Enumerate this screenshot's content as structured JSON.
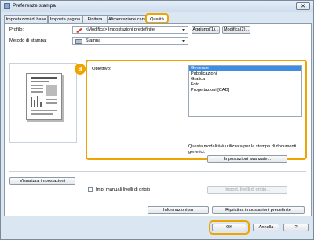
{
  "window": {
    "title": "Preferenze stampa",
    "close_label": "✕"
  },
  "tabs": [
    {
      "label": "Impostazioni di base"
    },
    {
      "label": "Imposta pagina"
    },
    {
      "label": "Finitura"
    },
    {
      "label": "Alimentazione carta"
    },
    {
      "label": "Qualità",
      "active": true
    }
  ],
  "profile": {
    "label": "Profilo:",
    "value": "<Modifica> Impostazioni predefinite",
    "add_button": "Aggiungi(1)...",
    "edit_button": "Modifica(2)..."
  },
  "output": {
    "label": "Metodo di stampa:",
    "value": "Stampa"
  },
  "objective": {
    "label": "Obiettivo:",
    "items": [
      "Generale",
      "Pubblicazioni",
      "Grafica",
      "Foto",
      "Progettazioni [CAD]"
    ],
    "selected": "Generale",
    "description": "Questa modalità è utilizzata per la stampa di documenti generici."
  },
  "callout": {
    "letter": "a"
  },
  "advanced_button": "Impostazioni avanzate...",
  "view_settings_button": "Visualizza impostazioni",
  "gray_checkbox_label": "Imp. manuali livelli di grigio",
  "gray_settings_button": "Impost. livelli di grigio...",
  "info_button": "Informazioni su",
  "restore_button": "Ripristina impostazioni predefinite",
  "ok_button": "OK",
  "cancel_button": "Annulla",
  "help_button": "?",
  "colors": {
    "accent": "#f0a400",
    "selection": "#3d8ee3"
  }
}
